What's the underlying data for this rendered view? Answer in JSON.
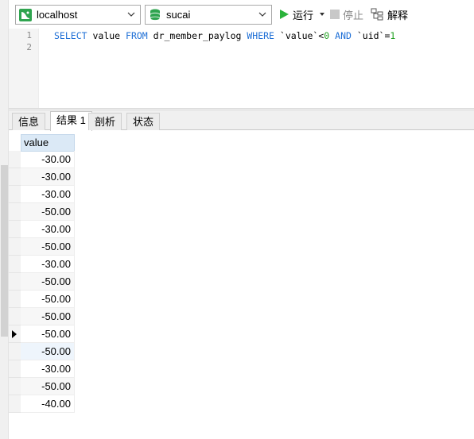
{
  "toolbar": {
    "connection": "localhost",
    "database": "sucai",
    "run_label": "运行",
    "stop_label": "停止",
    "explain_label": "解释"
  },
  "editor": {
    "line_numbers": [
      "1",
      "2"
    ],
    "sql": {
      "kw1": "SELECT",
      "t1": " value ",
      "kw2": "FROM",
      "t2": " dr_member_paylog ",
      "kw3": "WHERE",
      "t3": " `value`<",
      "n1": "0",
      "t4": " ",
      "kw4": "AND",
      "t5": " `uid`=",
      "n2": "1"
    }
  },
  "tabs": [
    "信息",
    "结果 1",
    "剖析",
    "状态"
  ],
  "active_tab": "结果 1",
  "result": {
    "column": "value",
    "rows": [
      "-30.00",
      "-30.00",
      "-30.00",
      "-50.00",
      "-30.00",
      "-50.00",
      "-30.00",
      "-50.00",
      "-50.00",
      "-50.00",
      "-50.00",
      "-50.00",
      "-30.00",
      "-50.00",
      "-40.00"
    ],
    "current_row_index": 10
  },
  "colors": {
    "keyword": "#1e6fd6",
    "number": "#22a022",
    "run_icon": "#2bb33b",
    "db_icon": "#2fa44f",
    "header_bg": "#dbe9f6"
  }
}
